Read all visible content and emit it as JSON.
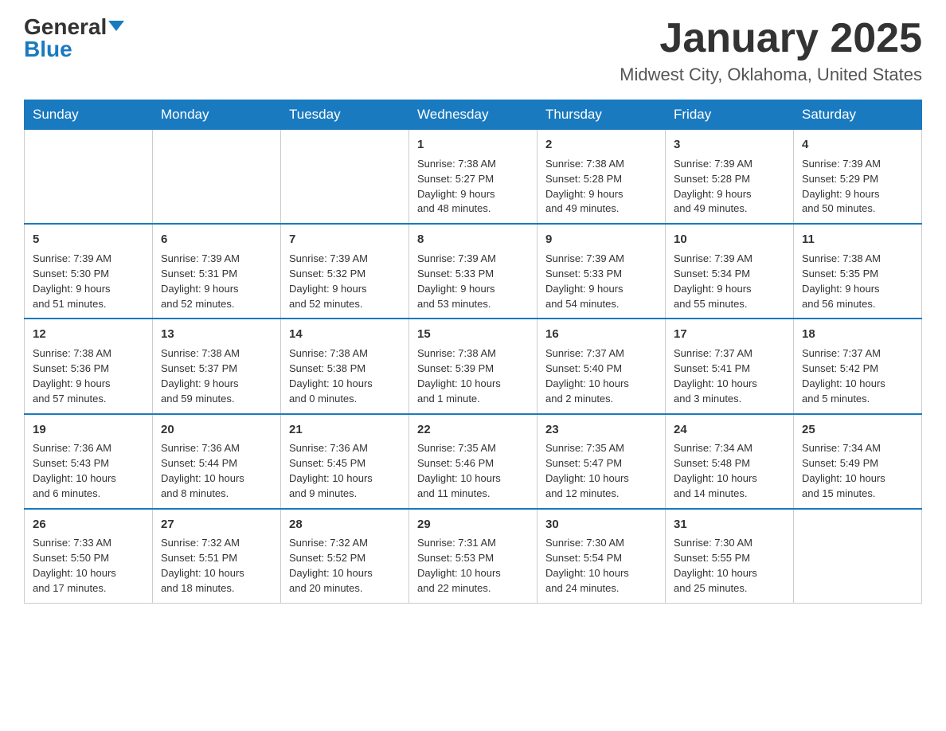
{
  "logo": {
    "general": "General",
    "blue": "Blue"
  },
  "title": "January 2025",
  "location": "Midwest City, Oklahoma, United States",
  "days_of_week": [
    "Sunday",
    "Monday",
    "Tuesday",
    "Wednesday",
    "Thursday",
    "Friday",
    "Saturday"
  ],
  "weeks": [
    [
      {
        "day": "",
        "info": ""
      },
      {
        "day": "",
        "info": ""
      },
      {
        "day": "",
        "info": ""
      },
      {
        "day": "1",
        "info": "Sunrise: 7:38 AM\nSunset: 5:27 PM\nDaylight: 9 hours\nand 48 minutes."
      },
      {
        "day": "2",
        "info": "Sunrise: 7:38 AM\nSunset: 5:28 PM\nDaylight: 9 hours\nand 49 minutes."
      },
      {
        "day": "3",
        "info": "Sunrise: 7:39 AM\nSunset: 5:28 PM\nDaylight: 9 hours\nand 49 minutes."
      },
      {
        "day": "4",
        "info": "Sunrise: 7:39 AM\nSunset: 5:29 PM\nDaylight: 9 hours\nand 50 minutes."
      }
    ],
    [
      {
        "day": "5",
        "info": "Sunrise: 7:39 AM\nSunset: 5:30 PM\nDaylight: 9 hours\nand 51 minutes."
      },
      {
        "day": "6",
        "info": "Sunrise: 7:39 AM\nSunset: 5:31 PM\nDaylight: 9 hours\nand 52 minutes."
      },
      {
        "day": "7",
        "info": "Sunrise: 7:39 AM\nSunset: 5:32 PM\nDaylight: 9 hours\nand 52 minutes."
      },
      {
        "day": "8",
        "info": "Sunrise: 7:39 AM\nSunset: 5:33 PM\nDaylight: 9 hours\nand 53 minutes."
      },
      {
        "day": "9",
        "info": "Sunrise: 7:39 AM\nSunset: 5:33 PM\nDaylight: 9 hours\nand 54 minutes."
      },
      {
        "day": "10",
        "info": "Sunrise: 7:39 AM\nSunset: 5:34 PM\nDaylight: 9 hours\nand 55 minutes."
      },
      {
        "day": "11",
        "info": "Sunrise: 7:38 AM\nSunset: 5:35 PM\nDaylight: 9 hours\nand 56 minutes."
      }
    ],
    [
      {
        "day": "12",
        "info": "Sunrise: 7:38 AM\nSunset: 5:36 PM\nDaylight: 9 hours\nand 57 minutes."
      },
      {
        "day": "13",
        "info": "Sunrise: 7:38 AM\nSunset: 5:37 PM\nDaylight: 9 hours\nand 59 minutes."
      },
      {
        "day": "14",
        "info": "Sunrise: 7:38 AM\nSunset: 5:38 PM\nDaylight: 10 hours\nand 0 minutes."
      },
      {
        "day": "15",
        "info": "Sunrise: 7:38 AM\nSunset: 5:39 PM\nDaylight: 10 hours\nand 1 minute."
      },
      {
        "day": "16",
        "info": "Sunrise: 7:37 AM\nSunset: 5:40 PM\nDaylight: 10 hours\nand 2 minutes."
      },
      {
        "day": "17",
        "info": "Sunrise: 7:37 AM\nSunset: 5:41 PM\nDaylight: 10 hours\nand 3 minutes."
      },
      {
        "day": "18",
        "info": "Sunrise: 7:37 AM\nSunset: 5:42 PM\nDaylight: 10 hours\nand 5 minutes."
      }
    ],
    [
      {
        "day": "19",
        "info": "Sunrise: 7:36 AM\nSunset: 5:43 PM\nDaylight: 10 hours\nand 6 minutes."
      },
      {
        "day": "20",
        "info": "Sunrise: 7:36 AM\nSunset: 5:44 PM\nDaylight: 10 hours\nand 8 minutes."
      },
      {
        "day": "21",
        "info": "Sunrise: 7:36 AM\nSunset: 5:45 PM\nDaylight: 10 hours\nand 9 minutes."
      },
      {
        "day": "22",
        "info": "Sunrise: 7:35 AM\nSunset: 5:46 PM\nDaylight: 10 hours\nand 11 minutes."
      },
      {
        "day": "23",
        "info": "Sunrise: 7:35 AM\nSunset: 5:47 PM\nDaylight: 10 hours\nand 12 minutes."
      },
      {
        "day": "24",
        "info": "Sunrise: 7:34 AM\nSunset: 5:48 PM\nDaylight: 10 hours\nand 14 minutes."
      },
      {
        "day": "25",
        "info": "Sunrise: 7:34 AM\nSunset: 5:49 PM\nDaylight: 10 hours\nand 15 minutes."
      }
    ],
    [
      {
        "day": "26",
        "info": "Sunrise: 7:33 AM\nSunset: 5:50 PM\nDaylight: 10 hours\nand 17 minutes."
      },
      {
        "day": "27",
        "info": "Sunrise: 7:32 AM\nSunset: 5:51 PM\nDaylight: 10 hours\nand 18 minutes."
      },
      {
        "day": "28",
        "info": "Sunrise: 7:32 AM\nSunset: 5:52 PM\nDaylight: 10 hours\nand 20 minutes."
      },
      {
        "day": "29",
        "info": "Sunrise: 7:31 AM\nSunset: 5:53 PM\nDaylight: 10 hours\nand 22 minutes."
      },
      {
        "day": "30",
        "info": "Sunrise: 7:30 AM\nSunset: 5:54 PM\nDaylight: 10 hours\nand 24 minutes."
      },
      {
        "day": "31",
        "info": "Sunrise: 7:30 AM\nSunset: 5:55 PM\nDaylight: 10 hours\nand 25 minutes."
      },
      {
        "day": "",
        "info": ""
      }
    ]
  ]
}
